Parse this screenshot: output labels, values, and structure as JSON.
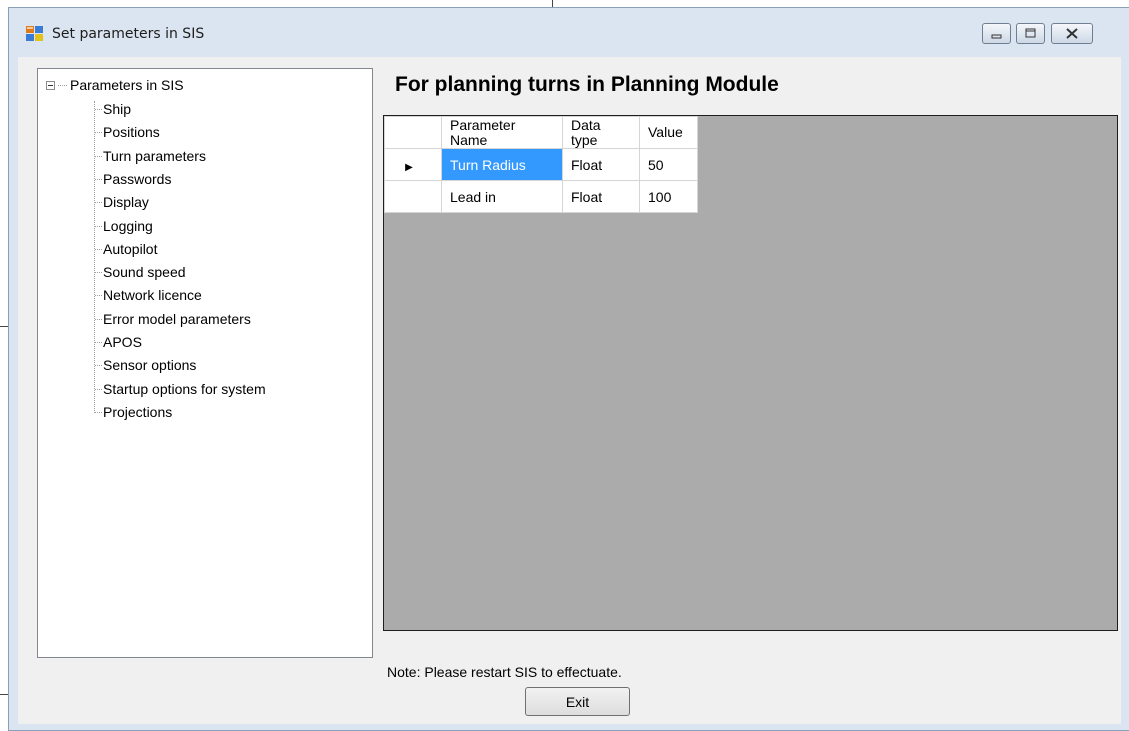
{
  "window": {
    "title": "Set parameters in SIS"
  },
  "tree": {
    "root_label": "Parameters in SIS",
    "items": [
      {
        "label": "Ship"
      },
      {
        "label": "Positions"
      },
      {
        "label": "Turn parameters"
      },
      {
        "label": "Passwords"
      },
      {
        "label": "Display"
      },
      {
        "label": "Logging"
      },
      {
        "label": "Autopilot"
      },
      {
        "label": "Sound speed"
      },
      {
        "label": "Network licence"
      },
      {
        "label": "Error model parameters"
      },
      {
        "label": "APOS"
      },
      {
        "label": "Sensor options"
      },
      {
        "label": "Startup options for system"
      },
      {
        "label": "Projections"
      }
    ]
  },
  "main": {
    "heading": "For planning turns in Planning Module",
    "grid": {
      "columns": [
        {
          "line1": "Parameter",
          "line2": "Name"
        },
        {
          "line1": "Data",
          "line2": "type"
        },
        {
          "line1": "Value",
          "line2": ""
        }
      ],
      "rows": [
        {
          "name": "Turn Radius",
          "type": "Float",
          "value": "50",
          "current": true,
          "row_marker": "▶"
        },
        {
          "name": "Lead in",
          "type": "Float",
          "value": "100",
          "current": false,
          "row_marker": ""
        }
      ],
      "selection_color": "#3399ff"
    },
    "note": "Note: Please restart SIS to effectuate.",
    "exit_label": "Exit"
  }
}
